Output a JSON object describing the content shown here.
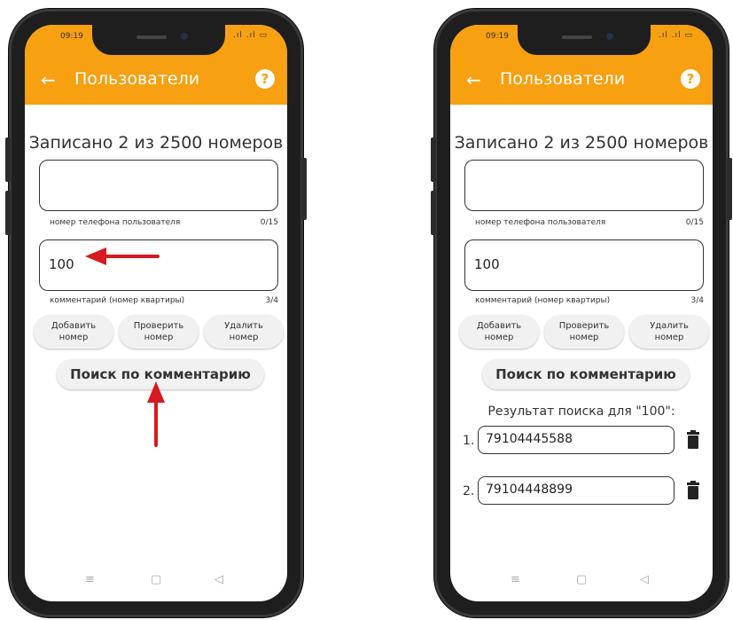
{
  "left": {
    "status": {
      "time": "09:19",
      "icons": ".ıl .ıl ▭"
    },
    "appbar": {
      "title": "Пользователи",
      "help": "?",
      "back": "←"
    },
    "counter": "Записано 2 из 2500 номеров",
    "phone_field": {
      "value": "",
      "helper": "номер телефона пользователя",
      "count": "0/15"
    },
    "comment_field": {
      "value": "100",
      "helper": "комментарий (номер квартиры)",
      "count": "3/4"
    },
    "buttons": {
      "add": "Добавить\nномер",
      "check": "Проверить\nномер",
      "delete": "Удалить\nномер"
    },
    "search_button": "Поиск по комментарию",
    "nav": {
      "menu": "≡",
      "home": "▢",
      "back": "◁"
    }
  },
  "right": {
    "status": {
      "time": "09:19",
      "icons": ".ıl .ıl ▭"
    },
    "appbar": {
      "title": "Пользователи",
      "help": "?",
      "back": "←"
    },
    "counter": "Записано 2 из 2500 номеров",
    "phone_field": {
      "value": "",
      "helper": "номер телефона пользователя",
      "count": "0/15"
    },
    "comment_field": {
      "value": "100",
      "helper": "комментарий (номер квартиры)",
      "count": "3/4"
    },
    "buttons": {
      "add": "Добавить\nномер",
      "check": "Проверить\nномер",
      "delete": "Удалить\nномер"
    },
    "search_button": "Поиск по комментарию",
    "result_title": "Результат поиска для \"100\":",
    "results": [
      {
        "num": "1.",
        "value": "79104445588"
      },
      {
        "num": "2.",
        "value": "79104448899"
      }
    ],
    "nav": {
      "menu": "≡",
      "home": "▢",
      "back": "◁"
    }
  },
  "colors": {
    "accent": "#f7a011",
    "annotation_arrow": "#d71920",
    "phone_body": "#1e1e1e"
  },
  "icons": [
    "back-arrow-icon",
    "help-icon",
    "trash-icon",
    "menu-icon",
    "home-icon",
    "nav-back-icon"
  ]
}
